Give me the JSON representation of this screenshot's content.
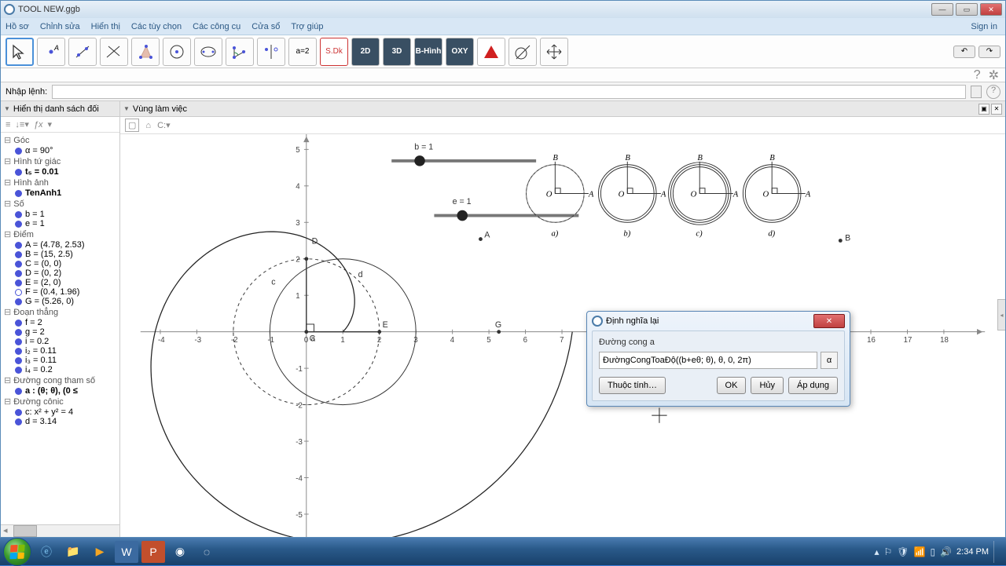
{
  "window": {
    "title": "TOOL NEW.ggb"
  },
  "menu": {
    "items": [
      "Hồ sơ",
      "Chỉnh sửa",
      "Hiển thị",
      "Các tùy chọn",
      "Các công cụ",
      "Cửa sổ",
      "Trợ giúp"
    ],
    "signin": "Sign in"
  },
  "inputbar": {
    "label": "Nhập lệnh:"
  },
  "panels": {
    "algebra_title": "Hiển thị danh sách đối",
    "graphics_title": "Vùng làm việc"
  },
  "algebra_fx": "ƒx",
  "algebra": [
    {
      "group": "Góc",
      "items": [
        {
          "label": "α = 90°",
          "dot": true
        }
      ]
    },
    {
      "group": "Hình tứ giác",
      "items": [
        {
          "label": "t₅ = 0.01",
          "dot": true,
          "bold": true
        }
      ]
    },
    {
      "group": "Hình ảnh",
      "items": [
        {
          "label": "TenAnh1",
          "dot": true,
          "bold": true
        }
      ]
    },
    {
      "group": "Số",
      "items": [
        {
          "label": "b = 1",
          "dot": true
        },
        {
          "label": "e = 1",
          "dot": true
        }
      ]
    },
    {
      "group": "Điểm",
      "items": [
        {
          "label": "A = (4.78, 2.53)",
          "dot": true
        },
        {
          "label": "B = (15, 2.5)",
          "dot": true
        },
        {
          "label": "C = (0, 0)",
          "dot": true
        },
        {
          "label": "D = (0, 2)",
          "dot": true
        },
        {
          "label": "E = (2, 0)",
          "dot": true
        },
        {
          "label": "F = (0.4, 1.96)",
          "dot": false
        },
        {
          "label": "G = (5.26, 0)",
          "dot": true
        }
      ]
    },
    {
      "group": "Đoạn thẳng",
      "items": [
        {
          "label": "f = 2",
          "dot": true
        },
        {
          "label": "g = 2",
          "dot": true
        },
        {
          "label": "i = 0.2",
          "dot": true
        },
        {
          "label": "i₂ = 0.11",
          "dot": true
        },
        {
          "label": "i₃ = 0.11",
          "dot": true
        },
        {
          "label": "i₄ = 0.2",
          "dot": true
        }
      ]
    },
    {
      "group": "Đường cong tham số",
      "items": [
        {
          "label": "a :  (θ; θ),     (0 ≤",
          "dot": true,
          "bold": true
        }
      ]
    },
    {
      "group": "Đường cônic",
      "items": [
        {
          "label": "c: x² + y² = 4",
          "dot": true
        },
        {
          "label": "d = 3.14",
          "dot": true
        }
      ]
    }
  ],
  "sliders": [
    {
      "label": "b = 1"
    },
    {
      "label": "e = 1"
    }
  ],
  "graph": {
    "x_ticks": [
      -4,
      -3,
      -2,
      -1,
      0,
      1,
      2,
      3,
      4,
      5,
      6,
      7,
      16,
      17,
      18
    ],
    "y_ticks": [
      -5,
      -4,
      -3,
      -2,
      -1,
      1,
      2,
      3,
      4,
      5
    ],
    "points": {
      "A": "A",
      "B": "B",
      "C": "C",
      "D": "D",
      "E": "E",
      "G": "G"
    },
    "curves": {
      "a": "a",
      "c": "c",
      "d": "d"
    },
    "diagram_labels": [
      "a)",
      "b)",
      "c)",
      "d)"
    ],
    "diagram_points": {
      "O": "O",
      "A": "A",
      "B": "B"
    }
  },
  "dialog": {
    "title": "Định nghĩa lại",
    "label": "Đường cong a",
    "value": "ĐườngCongToaĐộ((b+eθ; θ), θ, 0, 2π)",
    "alpha": "α",
    "buttons": {
      "props": "Thuộc tính…",
      "ok": "OK",
      "cancel": "Hủy",
      "apply": "Áp dụng"
    }
  },
  "toolbar_labels": {
    "a2": "a=2",
    "sdk": "S.Dk",
    "2d": "2D",
    "3d": "3D",
    "bh": "B-Hình",
    "oxy": "OXY"
  },
  "taskbar": {
    "time": "2:34 PM"
  }
}
